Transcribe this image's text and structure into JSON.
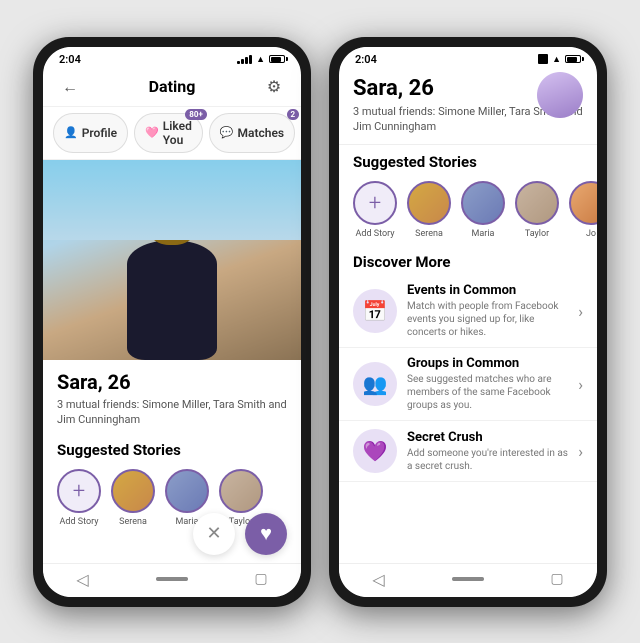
{
  "phone1": {
    "status_time": "2:04",
    "app_title": "Dating",
    "tabs": [
      {
        "label": "Profile",
        "icon": "👤",
        "badge": null
      },
      {
        "label": "Liked You",
        "icon": "🩷",
        "badge": "80+"
      },
      {
        "label": "Matches",
        "icon": "💬",
        "badge": "2"
      }
    ],
    "profile": {
      "name": "Sara, 26",
      "mutual": "3 mutual friends: Simone Miller, Tara Smith and Jim Cunningham"
    },
    "suggested_stories_title": "Suggested Stories",
    "stories": [
      {
        "name": "Add Story",
        "type": "add"
      },
      {
        "name": "Serena",
        "type": "person"
      },
      {
        "name": "Maria",
        "type": "person"
      },
      {
        "name": "Taylor",
        "type": "person"
      }
    ],
    "btn_x": "✕",
    "btn_heart": "♥",
    "back_icon": "←",
    "gear_icon": "⚙"
  },
  "phone2": {
    "status_time": "2:04",
    "profile": {
      "name": "Sara, 26",
      "mutual": "3 mutual friends: Simone Miller, Tara Smith and Jim Cunningham"
    },
    "suggested_stories_title": "Suggested Stories",
    "stories": [
      {
        "name": "Add Story",
        "type": "add"
      },
      {
        "name": "Serena",
        "type": "person"
      },
      {
        "name": "Maria",
        "type": "person"
      },
      {
        "name": "Taylor",
        "type": "person"
      },
      {
        "name": "Jo",
        "type": "person"
      }
    ],
    "discover_title": "Discover More",
    "discover_items": [
      {
        "icon": "📅",
        "title": "Events in Common",
        "desc": "Match with people from Facebook events you signed up for, like concerts or hikes."
      },
      {
        "icon": "👥",
        "title": "Groups in Common",
        "desc": "See suggested matches who are members of the same Facebook groups as you."
      },
      {
        "icon": "💜",
        "title": "Secret Crush",
        "desc": "Add someone you're interested in as a secret crush."
      }
    ]
  }
}
